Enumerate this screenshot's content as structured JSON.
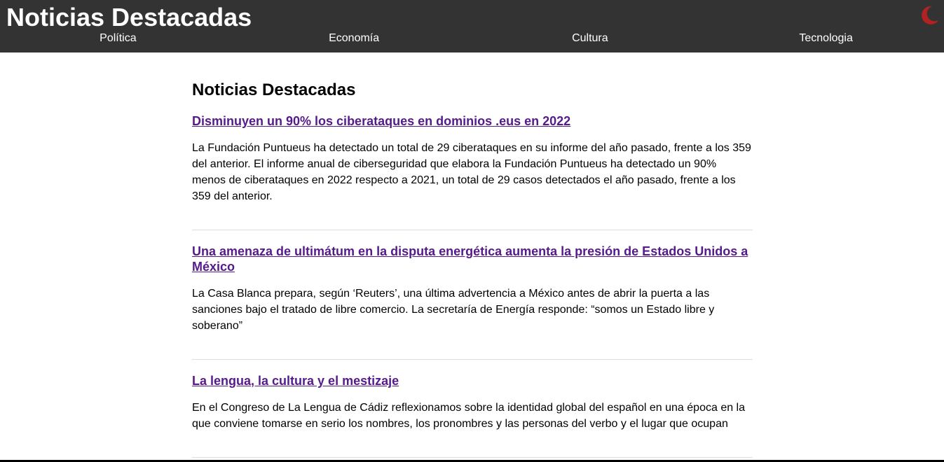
{
  "header": {
    "title": "Noticias Destacadas",
    "theme_icon": "moon-icon",
    "moon_color": "#b22222",
    "background": "#333333"
  },
  "nav": {
    "items": [
      {
        "label": "Política"
      },
      {
        "label": "Economía"
      },
      {
        "label": "Cultura"
      },
      {
        "label": "Tecnologia"
      }
    ]
  },
  "main": {
    "heading": "Noticias Destacadas",
    "articles": [
      {
        "title": "Disminuyen un 90% los ciberataques en dominios .eus en 2022",
        "body": "La Fundación Puntueus ha detectado un total de 29 ciberataques en su informe del año pasado, frente a los 359 del anterior. El informe anual de ciberseguridad que elabora la Fundación Puntueus ha detectado un 90% menos de ciberataques en 2022 respecto a 2021, un total de 29 casos detectados el año pasado, frente a los 359 del anterior."
      },
      {
        "title": "Una amenaza de ultimátum en la disputa energética aumenta la presión de Estados Unidos a México",
        "body": "La Casa Blanca prepara, según ‘Reuters’, una última advertencia a México antes de abrir la puerta a las sanciones bajo el tratado de libre comercio. La secretaría de Energía responde: “somos un Estado libre y soberano”"
      },
      {
        "title": "La lengua, la cultura y el mestizaje",
        "body": "En el Congreso de La Lengua de Cádiz reflexionamos sobre la identidad global del español en una época en la que conviene tomarse en serio los nombres, los pronombres y las personas del verbo y el lugar que ocupan"
      }
    ]
  }
}
